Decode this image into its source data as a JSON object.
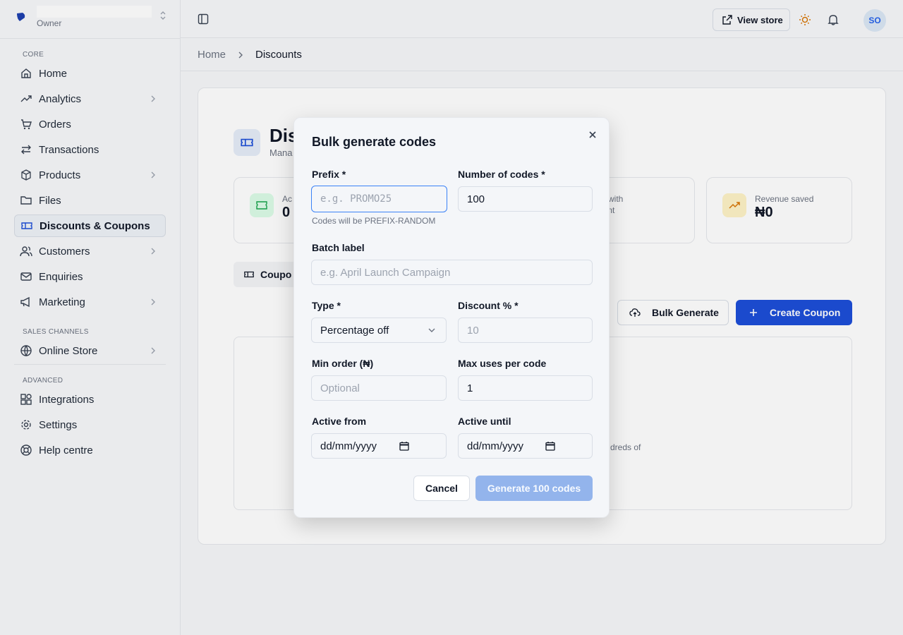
{
  "brand": {
    "role": "Owner"
  },
  "sidebar": {
    "sections": {
      "core": "CORE",
      "sales": "SALES CHANNELS",
      "advanced": "ADVANCED"
    },
    "items": [
      {
        "label": "Home",
        "icon": "home-icon"
      },
      {
        "label": "Analytics",
        "icon": "trending-up-icon"
      },
      {
        "label": "Orders",
        "icon": "cart-icon"
      },
      {
        "label": "Transactions",
        "icon": "swap-icon"
      },
      {
        "label": "Products",
        "icon": "box-icon"
      },
      {
        "label": "Files",
        "icon": "folder-icon"
      },
      {
        "label": "Discounts & Coupons",
        "icon": "ticket-icon"
      },
      {
        "label": "Customers",
        "icon": "users-icon"
      },
      {
        "label": "Enquiries",
        "icon": "mail-icon"
      },
      {
        "label": "Marketing",
        "icon": "megaphone-icon"
      },
      {
        "label": "Online Store",
        "icon": "globe-icon"
      },
      {
        "label": "Integrations",
        "icon": "puzzle-icon"
      },
      {
        "label": "Settings",
        "icon": "gear-icon"
      },
      {
        "label": "Help centre",
        "icon": "lifebuoy-icon"
      }
    ]
  },
  "topbar": {
    "view_store": "View store",
    "avatar": "SO"
  },
  "breadcrumb": {
    "home": "Home",
    "current": "Discounts"
  },
  "page": {
    "title": "Dis",
    "subtitle": "Mana",
    "stats": [
      {
        "label": "Ac",
        "value": "0"
      },
      {
        "label": "ers with\ncount",
        "value": ""
      },
      {
        "label": "Revenue saved",
        "value": "₦0"
      }
    ],
    "tab": "Coupo",
    "bulk_button": "Bulk Generate",
    "create_button": "Create Coupon",
    "empty_text": "dreds of"
  },
  "modal": {
    "title": "Bulk generate codes",
    "prefix": {
      "label": "Prefix *",
      "placeholder": "e.g. PROMO25",
      "hint": "Codes will be PREFIX-RANDOM"
    },
    "count": {
      "label": "Number of codes *",
      "value": "100"
    },
    "batch": {
      "label": "Batch label",
      "placeholder": "e.g. April Launch Campaign"
    },
    "type": {
      "label": "Type *",
      "value": "Percentage off"
    },
    "discount": {
      "label": "Discount % *",
      "placeholder": "10"
    },
    "min_order": {
      "label": "Min order (₦)",
      "placeholder": "Optional"
    },
    "max_uses": {
      "label": "Max uses per code",
      "value": "1"
    },
    "active_from": {
      "label": "Active from",
      "value": "dd/mm/yyyy"
    },
    "active_until": {
      "label": "Active until",
      "value": "dd/mm/yyyy"
    },
    "cancel": "Cancel",
    "generate": "Generate 100 codes"
  },
  "colors": {
    "accent": "#1d4ed8",
    "focus": "#3b82f6",
    "generate_disabled": "#93b4ec"
  }
}
